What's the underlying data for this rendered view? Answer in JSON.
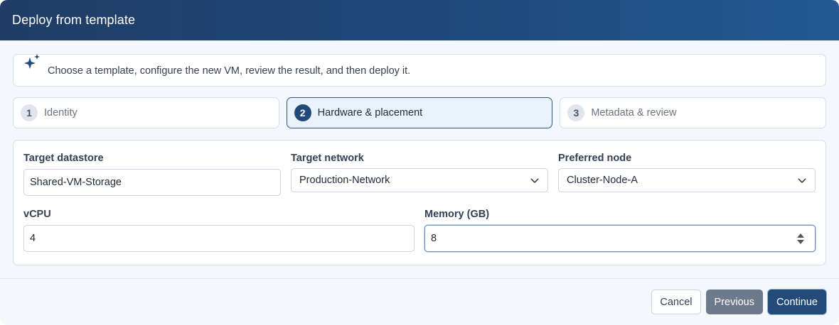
{
  "dialog": {
    "title": "Deploy from template"
  },
  "intro": {
    "icon": "sparkles-icon",
    "text": "Choose a template, configure the new VM, review the result, and then deploy it."
  },
  "steps": [
    {
      "number": "1",
      "label": "Identity",
      "state": "inactive"
    },
    {
      "number": "2",
      "label": "Hardware & placement",
      "state": "active"
    },
    {
      "number": "3",
      "label": "Metadata & review",
      "state": "inactive"
    }
  ],
  "form": {
    "target_datastore": {
      "label": "Target datastore",
      "value": "Shared-VM-Storage"
    },
    "target_network": {
      "label": "Target network",
      "value": "Production-Network"
    },
    "preferred_node": {
      "label": "Preferred node",
      "value": "Cluster-Node-A"
    },
    "vcpu": {
      "label": "vCPU",
      "value": "4"
    },
    "memory": {
      "label": "Memory (GB)",
      "value": "8"
    }
  },
  "footer": {
    "cancel_label": "Cancel",
    "previous_label": "Previous",
    "continue_label": "Continue"
  },
  "colors": {
    "header": "#1f3d66",
    "accent": "#234a78",
    "secondary_button": "#6c7a8c"
  }
}
